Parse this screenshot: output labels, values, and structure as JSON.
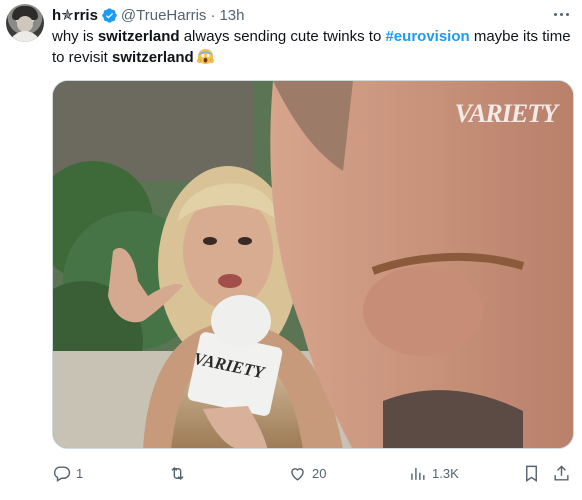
{
  "tweet": {
    "display_name": "h✯rris",
    "handle": "@TrueHarris",
    "separator": "·",
    "time": "13h",
    "text_parts": {
      "p1": "why is ",
      "p2": "switzerland",
      "p3": " always sending cute twinks to ",
      "p4": "#eurovision",
      "p5": " maybe its time to revisit ",
      "p6": "switzerland"
    },
    "emoji": "face-screaming-in-fear"
  },
  "media": {
    "watermark": "VARIETY",
    "mic_label": "VARIETY"
  },
  "actions": {
    "reply_count": "1",
    "repost_count": "",
    "like_count": "20",
    "views_count": "1.3K"
  },
  "colors": {
    "accent": "#1d9bf0",
    "secondary_text": "#536471"
  },
  "icons": [
    "verified-badge-icon",
    "more-icon",
    "reply-icon",
    "repost-icon",
    "like-icon",
    "views-icon",
    "bookmark-icon",
    "share-icon"
  ]
}
